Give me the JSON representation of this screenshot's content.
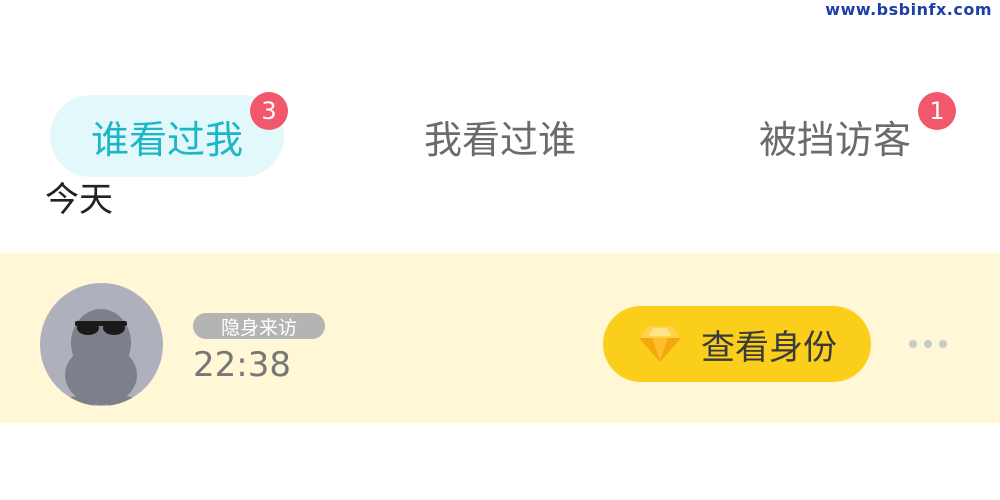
{
  "watermark": "www.bsbinfx.com",
  "tabs": [
    {
      "label": "谁看过我",
      "badge": "3",
      "active": true
    },
    {
      "label": "我看过谁",
      "badge": "",
      "active": false
    },
    {
      "label": "被挡访客",
      "badge": "1",
      "active": false
    }
  ],
  "section": {
    "label": "今天"
  },
  "visitor": {
    "tag": "隐身来访",
    "time": "22:38",
    "button_label": "查看身份"
  },
  "icons": {
    "avatar": "anonymous-penguin-icon",
    "button": "diamond-icon",
    "more": "more-dots-icon"
  },
  "colors": {
    "accent": "#1bb7c6",
    "badge": "#f2586c",
    "button": "#fbce1b",
    "row_bg": "#fff7d6"
  }
}
